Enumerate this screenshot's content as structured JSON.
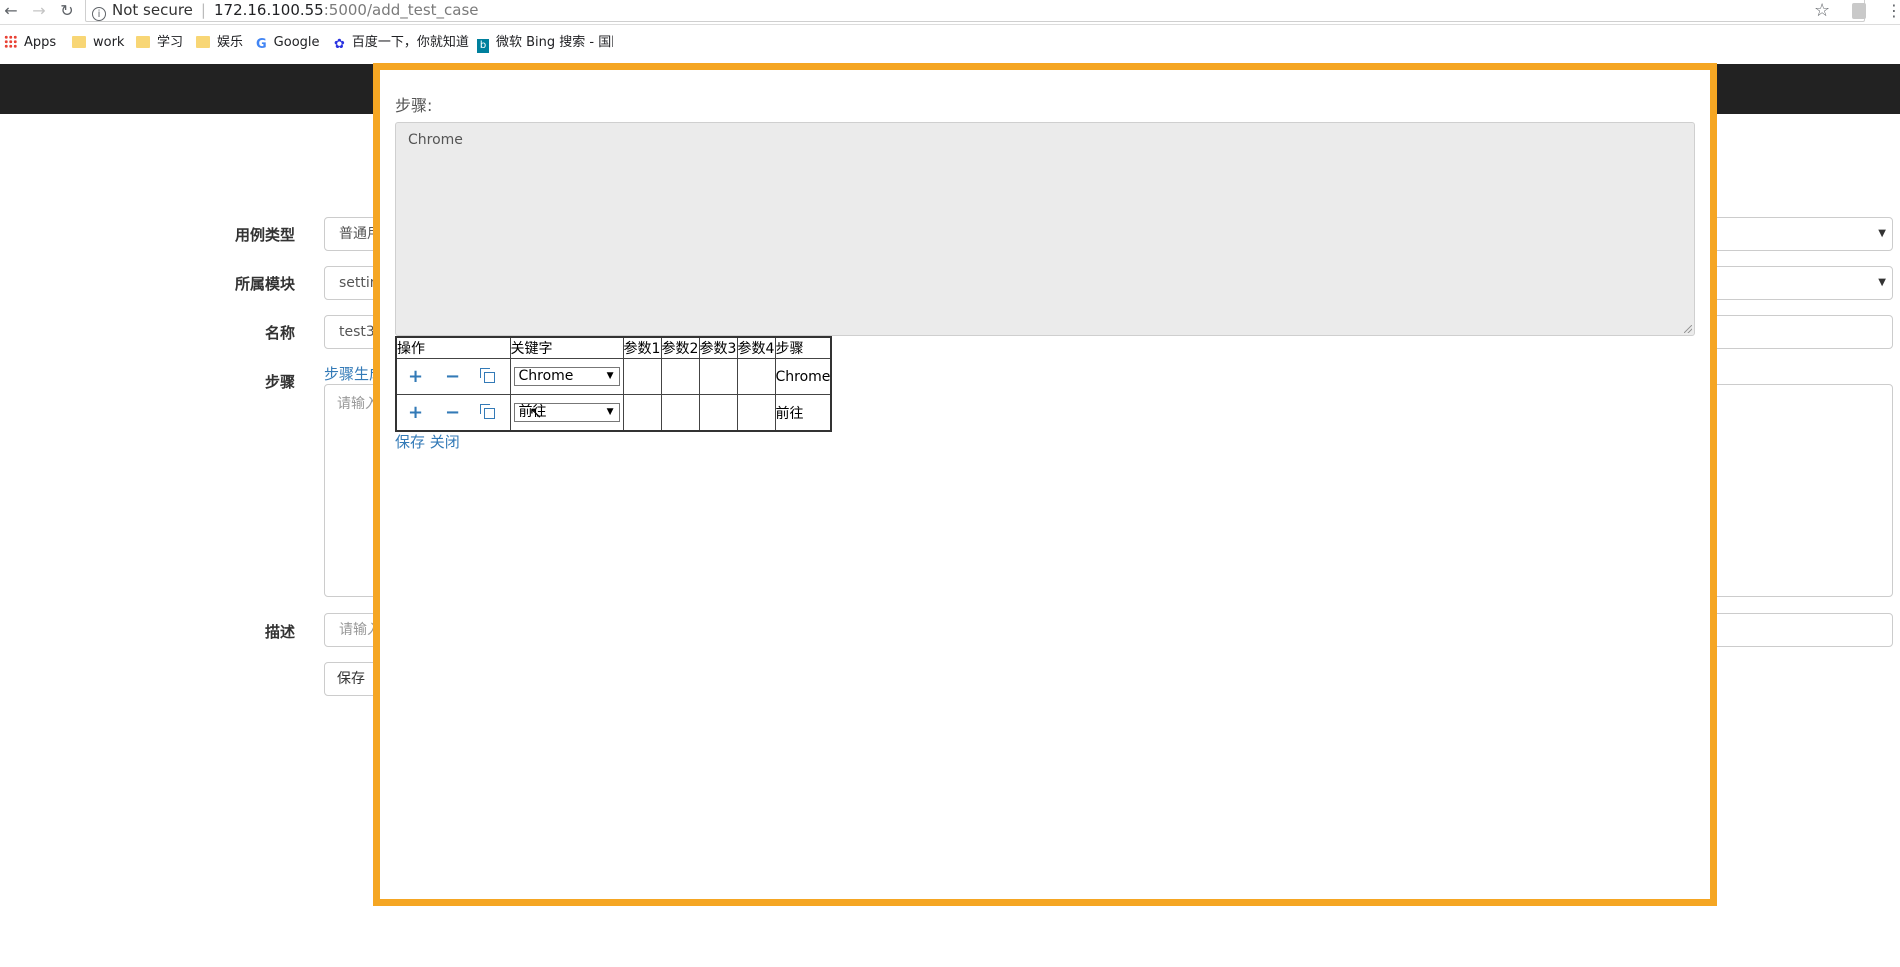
{
  "browser": {
    "security_label": "Not secure",
    "url_host": "172.16.100.55",
    "url_path": ":5000/add_test_case",
    "bookmarks": [
      {
        "label": "Apps",
        "icon": "apps-grid-icon"
      },
      {
        "label": "work",
        "icon": "folder-icon"
      },
      {
        "label": "学习",
        "icon": "folder-icon"
      },
      {
        "label": "娱乐",
        "icon": "folder-icon"
      },
      {
        "label": "Google",
        "icon": "google-icon"
      },
      {
        "label": "百度一下，你就知道",
        "icon": "baidu-icon"
      },
      {
        "label": "微软 Bing 搜索 - 国际",
        "icon": "bing-icon"
      }
    ]
  },
  "form": {
    "case_type_label": "用例类型",
    "case_type_value": "普通用",
    "module_label": "所属模块",
    "module_value": "settin",
    "name_label": "名称",
    "name_value": "test3",
    "steps_label": "步骤",
    "steps_link": "步骤生成",
    "steps_placeholder": "请输入",
    "desc_label": "描述",
    "desc_placeholder": "请输入",
    "save_button": "保存"
  },
  "modal": {
    "steps_title": "步骤:",
    "steps_text": "Chrome",
    "table": {
      "headers": [
        "操作",
        "关键字",
        "参数1",
        "参数2",
        "参数3",
        "参数4",
        "步骤"
      ],
      "rows": [
        {
          "keyword": "Chrome",
          "p1": "",
          "p2": "",
          "p3": "",
          "p4": "",
          "step": "Chrome"
        },
        {
          "keyword": "前往",
          "p1": "",
          "p2": "",
          "p3": "",
          "p4": "",
          "step": "前往"
        }
      ],
      "op_add": "+",
      "op_remove": "−"
    },
    "save_link": "保存",
    "close_link": "关闭"
  },
  "colors": {
    "modal_border": "#f5a623",
    "navbar": "#222222",
    "link": "#337ab7"
  }
}
